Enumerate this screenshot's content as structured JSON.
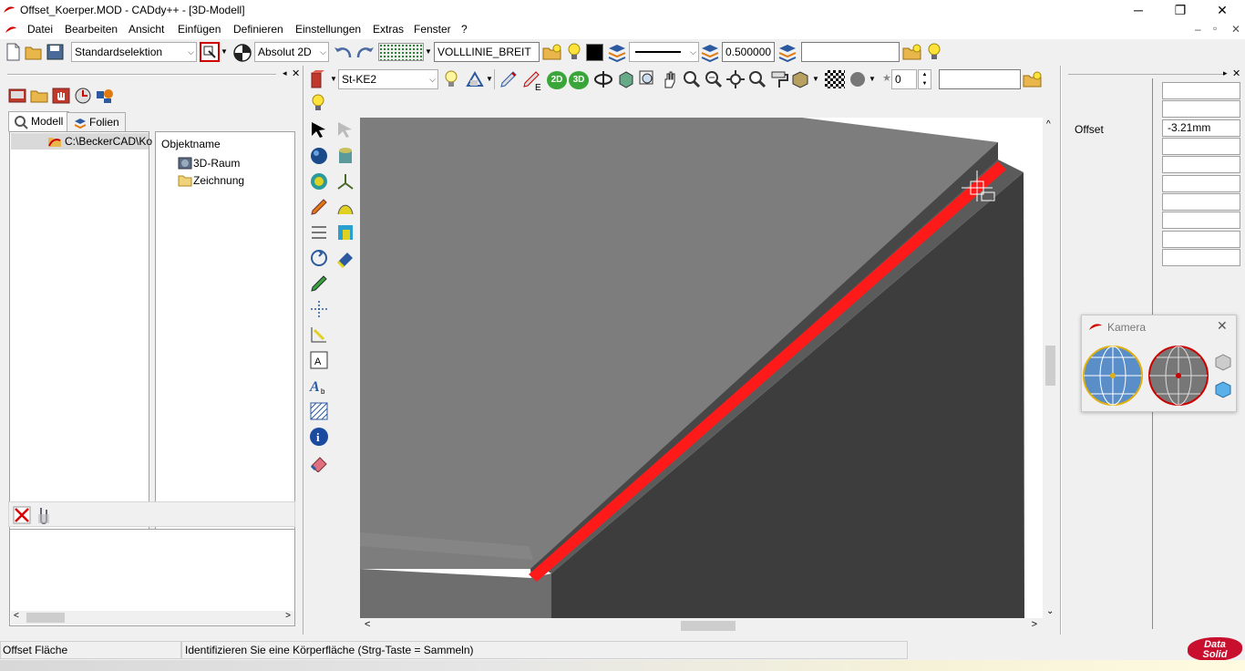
{
  "window": {
    "title": "Offset_Koerper.MOD  -  CADdy++ - [3D-Modell]",
    "minimize_glyph": "─",
    "maximize_glyph": "❐",
    "close_glyph": "✕"
  },
  "menubar": {
    "items": [
      "Datei",
      "Bearbeiten",
      "Ansicht",
      "Einfügen",
      "Definieren",
      "Einstellungen",
      "Extras",
      "Fenster",
      "?"
    ],
    "mdi_controls": [
      "–",
      "▫",
      "✕"
    ]
  },
  "toolbar1": {
    "selection_mode": "Standardselektion",
    "coord_mode": "Absolut 2D",
    "line_type": "VOLLLINIE_BREIT",
    "line_width": "0.500000",
    "layer_field": ""
  },
  "toolbar2": {
    "material": "St-KE2",
    "label_2d": "2D",
    "label_3d": "3D",
    "spin_value": "0",
    "text_field": ""
  },
  "left_panel": {
    "tabs": [
      "Modell",
      "Folien"
    ],
    "path_item": "C:\\BeckerCAD\\Ko",
    "column_header": "Objektname",
    "tree_items": [
      "3D-Raum",
      "Zeichnung"
    ]
  },
  "properties": {
    "offset_label": "Offset",
    "offset_value": "-3.21mm"
  },
  "camera": {
    "title": "Kamera"
  },
  "statusbar": {
    "mode": "Offset Fläche",
    "prompt": "Identifizieren Sie eine Körperfläche (Strg-Taste = Sammeln)",
    "brand_line1": "Data",
    "brand_line2": "Solid"
  },
  "colors": {
    "accent_red": "#e00000",
    "selection_red": "#ff1a1a",
    "viewport_face_light": "#7a7a7a",
    "viewport_face_dark": "#3d3d3d"
  }
}
